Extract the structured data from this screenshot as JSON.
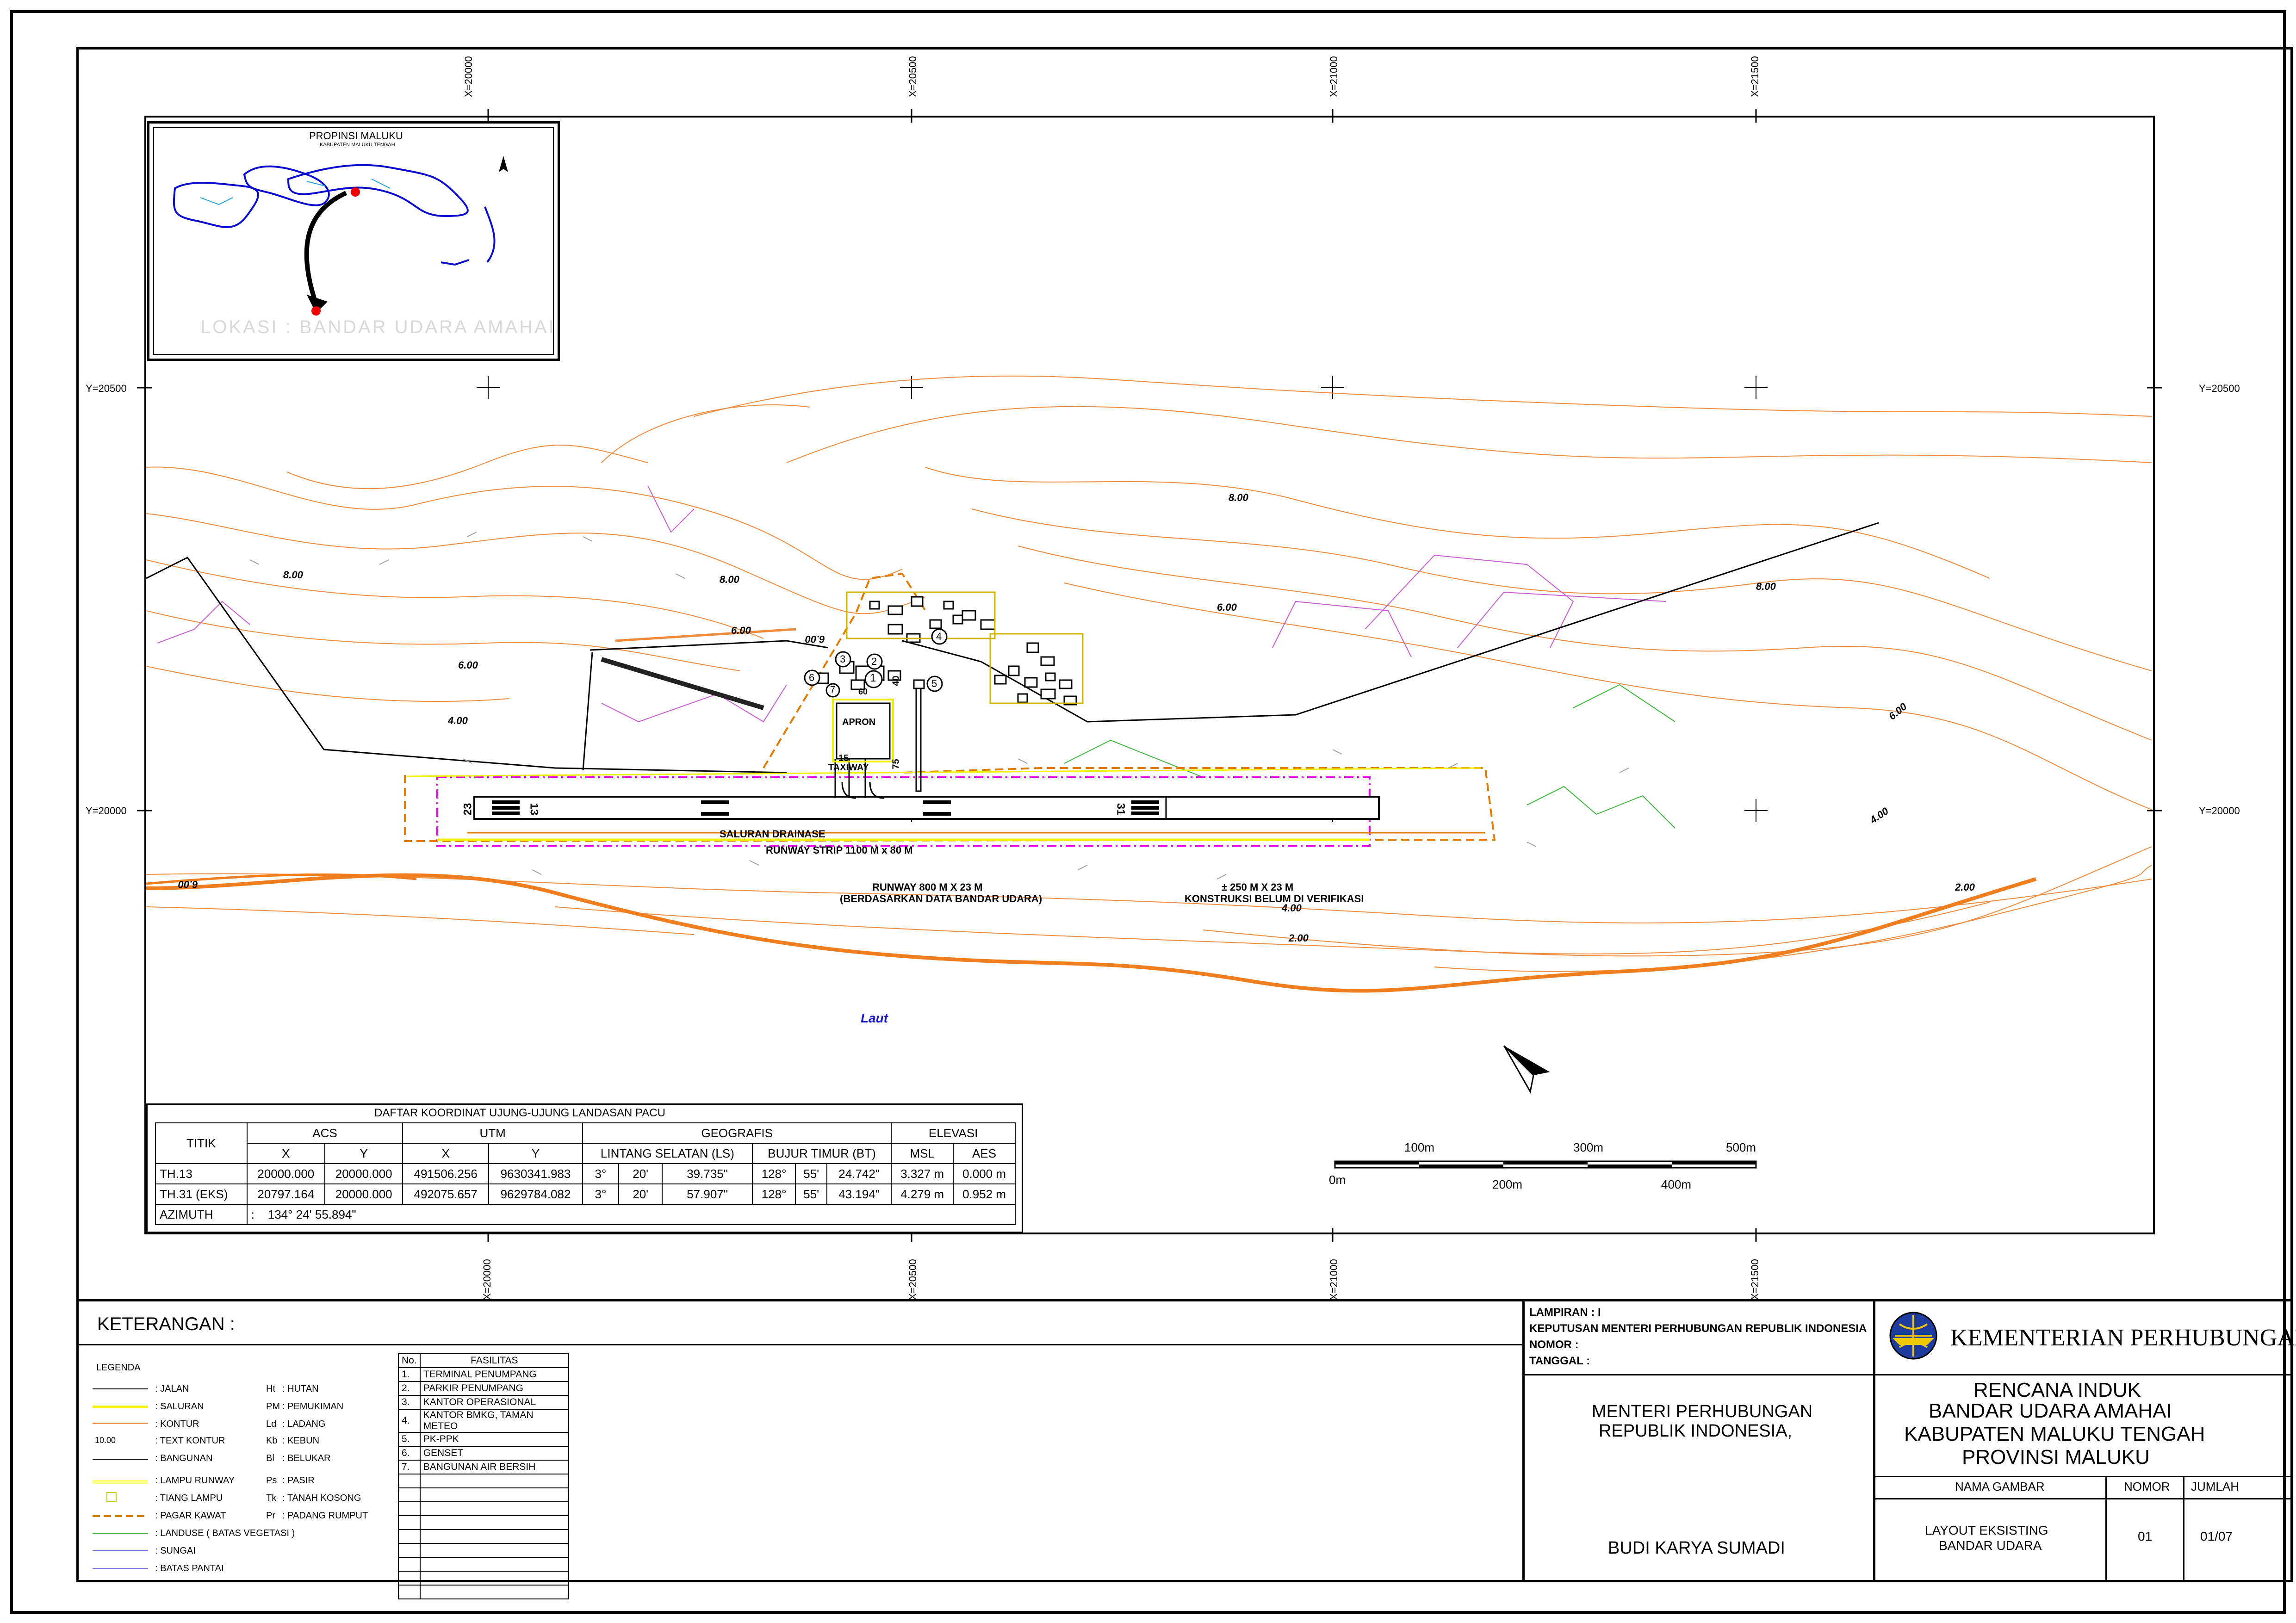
{
  "grid": {
    "x_labels": [
      "X=20000",
      "X=20500",
      "X=21000",
      "X=21500"
    ],
    "y_labels": [
      "Y=20500",
      "Y=20000"
    ]
  },
  "inset": {
    "title": "PROPINSI MALUKU",
    "subtitle": "KABUPATEN MALUKU TENGAH",
    "location": "LOKASI : BANDAR UDARA AMAHAI"
  },
  "map_labels": {
    "apron": "APRON",
    "taxiway": "TAXIWAY",
    "drainage": "SALURAN DRAINASE",
    "runway_strip": "RUNWAY STRIP 1100 M x 80 M",
    "runway_line1": "RUNWAY 800 M X 23 M",
    "runway_line2": "(BERDASARKAN DATA BANDAR UDARA)",
    "extension_line1": "± 250 M X 23 M",
    "extension_line2": "KONSTRUKSI BELUM DI VERIFIKASI",
    "sea": "Laut",
    "rwy_23": "23",
    "rwy_13": "13",
    "rwy_31": "31",
    "twy_15": "15",
    "twy_40": "40",
    "twy_75": "75",
    "apron_60": "60",
    "contours": [
      "8.00",
      "8.00",
      "6.00",
      "6.00",
      "6.00",
      "4.00",
      "8.00",
      "6.00",
      "6.00",
      "4.00",
      "2.00",
      "4.00",
      "2.00",
      "6.00",
      "8.00"
    ],
    "facility_markers": [
      "1",
      "2",
      "3",
      "4",
      "5",
      "6",
      "7"
    ]
  },
  "scale_bar": {
    "top_labels": [
      "100m",
      "300m",
      "500m"
    ],
    "bottom_labels": [
      "0m",
      "200m",
      "400m"
    ]
  },
  "coord_table": {
    "title": "DAFTAR KOORDINAT UJUNG-UJUNG LANDASAN PACU",
    "h_titik": "TITIK",
    "h_acs": "ACS",
    "h_utm": "UTM",
    "h_geo": "GEOGRAFIS",
    "h_elev": "ELEVASI",
    "h_x": "X",
    "h_y": "Y",
    "h_ls": "LINTANG SELATAN (LS)",
    "h_bt": "BUJUR TIMUR (BT)",
    "h_msl": "MSL",
    "h_aes": "AES",
    "rows": [
      {
        "titik": "TH.13",
        "acs_x": "20000.000",
        "acs_y": "20000.000",
        "utm_x": "491506.256",
        "utm_y": "9630341.983",
        "ls_d": "3°",
        "ls_m": "20'",
        "ls_s": "39.735\"",
        "bt_d": "128°",
        "bt_m": "55'",
        "bt_s": "24.742\"",
        "msl": "3.327 m",
        "aes": "0.000 m"
      },
      {
        "titik": "TH.31 (EKS)",
        "acs_x": "20797.164",
        "acs_y": "20000.000",
        "utm_x": "492075.657",
        "utm_y": "9629784.082",
        "ls_d": "3°",
        "ls_m": "20'",
        "ls_s": "57.907\"",
        "bt_d": "128°",
        "bt_m": "55'",
        "bt_s": "43.194\"",
        "msl": "4.279 m",
        "aes": "0.952 m"
      }
    ],
    "azimuth_label": "AZIMUTH",
    "azimuth_sep": ":",
    "azimuth_value": "134° 24' 55.894\""
  },
  "keterangan": {
    "title": "KETERANGAN :",
    "legenda": "LEGENDA",
    "items_left": [
      ": JALAN",
      ": SALURAN",
      ": KONTUR",
      ": TEXT KONTUR",
      ": BANGUNAN",
      ": LAMPU RUNWAY",
      ": TIANG LAMPU",
      ": PAGAR KAWAT",
      ": LANDUSE ( BATAS VEGETASI )",
      ": SUNGAI",
      ": BATAS PANTAI"
    ],
    "text_kontur_sample": "10.00",
    "items_right_code": [
      "Ht",
      "PM",
      "Ld",
      "Kb",
      "Bl",
      "Ps",
      "Tk",
      "Pr"
    ],
    "items_right_name": [
      ": HUTAN",
      ": PEMUKIMAN",
      ": LADANG",
      ": KEBUN",
      ": BELUKAR",
      ": PASIR",
      ": TANAH KOSONG",
      ": PADANG RUMPUT"
    ]
  },
  "fasilitas": {
    "h_no": "No.",
    "h_name": "FASILITAS",
    "rows": [
      {
        "no": "1.",
        "name": "TERMINAL PENUMPANG"
      },
      {
        "no": "2.",
        "name": "PARKIR PENUMPANG"
      },
      {
        "no": "3.",
        "name": "KANTOR OPERASIONAL"
      },
      {
        "no": "4.",
        "name": "KANTOR BMKG, TAMAN METEO"
      },
      {
        "no": "5.",
        "name": "PK-PPK"
      },
      {
        "no": "6.",
        "name": "GENSET"
      },
      {
        "no": "7.",
        "name": "BANGUNAN AIR BERSIH"
      }
    ]
  },
  "lampiran": {
    "line1": "LAMPIRAN : I",
    "line2": "KEPUTUSAN MENTERI PERHUBUNGAN REPUBLIK INDONESIA",
    "line3": "NOMOR     :",
    "line4": "TANGGAL  :"
  },
  "signatory": {
    "title1": "MENTERI PERHUBUNGAN",
    "title2": "REPUBLIK INDONESIA,",
    "name": "BUDI KARYA SUMADI"
  },
  "ministry": {
    "name": "KEMENTERIAN PERHUBUNGAN"
  },
  "project": {
    "line1": "RENCANA INDUK",
    "line2": "BANDAR UDARA AMAHAI",
    "line3": "KABUPATEN MALUKU TENGAH",
    "line4": "PROVINSI MALUKU"
  },
  "drawing_info": {
    "h_nama": "NAMA GAMBAR",
    "h_nomor": "NOMOR",
    "h_jumlah": "JUMLAH",
    "nama_line1": "LAYOUT EKSISTING",
    "nama_line2": "BANDAR UDARA",
    "nomor": "01",
    "jumlah": "01/07"
  },
  "colors": {
    "contour": "#f08a3c",
    "coast": "#f07d1e",
    "road": "#000000",
    "pagar": "#e07a00",
    "landuse": "#c85ad2",
    "strip": "#e600e6",
    "saluran": "#f0f000",
    "sea_label": "#1a1ad2",
    "island": "#0a0ad2"
  }
}
